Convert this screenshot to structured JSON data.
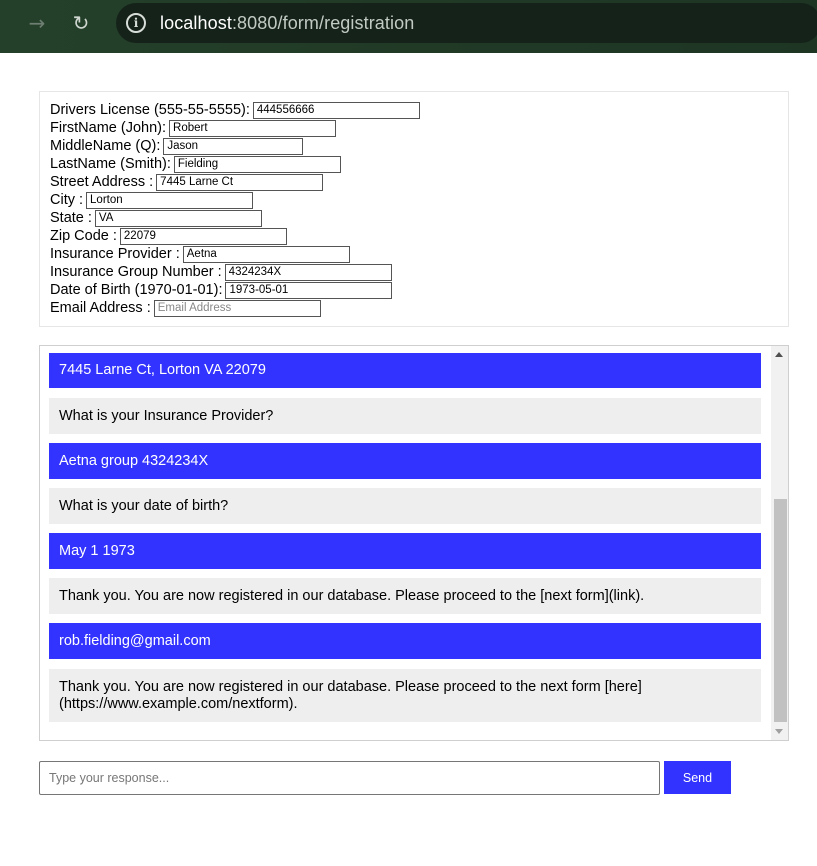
{
  "browser": {
    "forward_icon": "arrow-right-icon",
    "reload_icon": "reload-icon",
    "info_icon": "info-icon",
    "url_host": "localhost",
    "url_path": ":8080/form/registration"
  },
  "form": {
    "fields": [
      {
        "label": "Drivers License (555-55-5555):",
        "value": "444556666",
        "placeholder": ""
      },
      {
        "label": "FirstName (John):",
        "value": "Robert",
        "placeholder": ""
      },
      {
        "label": "MiddleName (Q):",
        "value": "Jason",
        "placeholder": ""
      },
      {
        "label": "LastName (Smith):",
        "value": "Fielding",
        "placeholder": ""
      },
      {
        "label": "Street Address :",
        "value": "7445 Larne Ct",
        "placeholder": ""
      },
      {
        "label": "City :",
        "value": "Lorton",
        "placeholder": ""
      },
      {
        "label": "State :",
        "value": "VA",
        "placeholder": ""
      },
      {
        "label": "Zip Code :",
        "value": "22079",
        "placeholder": ""
      },
      {
        "label": "Insurance Provider :",
        "value": "Aetna",
        "placeholder": ""
      },
      {
        "label": "Insurance Group Number :",
        "value": "4324234X",
        "placeholder": ""
      },
      {
        "label": "Date of Birth (1970-01-01):",
        "value": "1973-05-01",
        "placeholder": ""
      },
      {
        "label": "Email Address :",
        "value": "",
        "placeholder": "Email Address"
      }
    ]
  },
  "chat": {
    "messages": [
      {
        "role": "user",
        "text": "7445 Larne Ct, Lorton VA 22079"
      },
      {
        "role": "bot",
        "text": "What is your Insurance Provider?"
      },
      {
        "role": "user",
        "text": "Aetna group 4324234X"
      },
      {
        "role": "bot",
        "text": "What is your date of birth?"
      },
      {
        "role": "user",
        "text": "May 1 1973"
      },
      {
        "role": "bot",
        "text": "Thank you. You are now registered in our database. Please proceed to the [next form](link)."
      },
      {
        "role": "user",
        "text": "rob.fielding@gmail.com"
      },
      {
        "role": "bot",
        "text": "Thank you. You are now registered in our database. Please proceed to the next form [here](https://www.example.com/nextform)."
      }
    ]
  },
  "composer": {
    "placeholder": "Type your response...",
    "send_label": "Send"
  },
  "colors": {
    "user_bubble": "#3333ff",
    "bot_bubble": "#eeeeee",
    "send_button": "#3333ff"
  }
}
